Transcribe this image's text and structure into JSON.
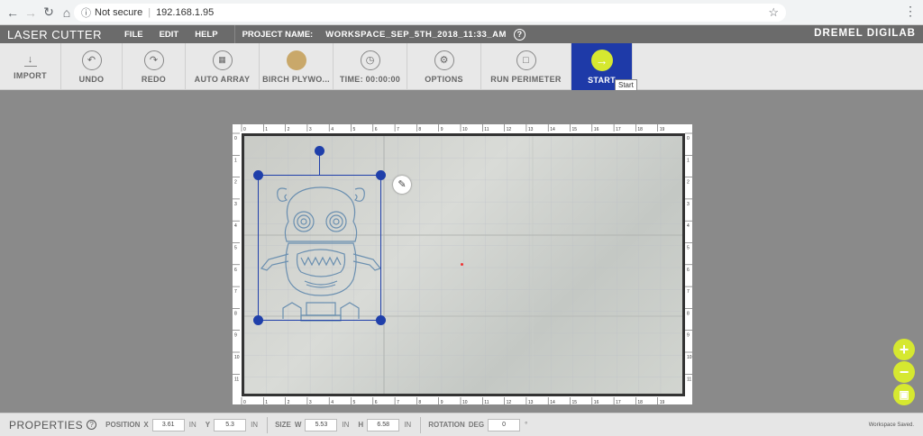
{
  "browser": {
    "security": "Not secure",
    "url": "192.168.1.95"
  },
  "app": {
    "title": "LASER CUTTER",
    "menu": [
      "FILE",
      "EDIT",
      "HELP"
    ],
    "project_label": "PROJECT NAME:",
    "project_name": "WORKSPACE_SEP_5TH_2018_11:33_AM",
    "brand": "DREMEL DIGILAB"
  },
  "toolbar": {
    "import": "IMPORT",
    "undo": "UNDO",
    "redo": "REDO",
    "auto_array": "AUTO ARRAY",
    "material": "BIRCH PLYWO...",
    "time": "TIME: 00:00:00",
    "options": "OPTIONS",
    "run_perimeter": "RUN PERIMETER",
    "start": "START",
    "tooltip": "Start"
  },
  "rulers": {
    "top": [
      "0",
      "1",
      "2",
      "3",
      "4",
      "5",
      "6",
      "7",
      "8",
      "9",
      "10",
      "11",
      "12",
      "13",
      "14",
      "15",
      "16",
      "17",
      "18",
      "19"
    ],
    "left": [
      "0",
      "1",
      "2",
      "3",
      "4",
      "5",
      "6",
      "7",
      "8",
      "9",
      "10",
      "11"
    ]
  },
  "properties": {
    "title": "PROPERTIES",
    "position_label": "POSITION",
    "x_label": "X",
    "x_value": "3.61",
    "x_unit": "IN",
    "y_label": "Y",
    "y_value": "5.3",
    "y_unit": "IN",
    "size_label": "SIZE",
    "w_label": "W",
    "w_value": "5.53",
    "w_unit": "IN",
    "h_label": "H",
    "h_value": "6.58",
    "h_unit": "IN",
    "rotation_label": "ROTATION",
    "deg_label": "DEG",
    "deg_value": "0",
    "deg_symbol": "°",
    "status": "Workspace Saved."
  },
  "colors": {
    "accent": "#d6e830",
    "selection": "#1f3faa",
    "start_bg": "#1e3aa8",
    "design_stroke": "#6a8fb0"
  }
}
